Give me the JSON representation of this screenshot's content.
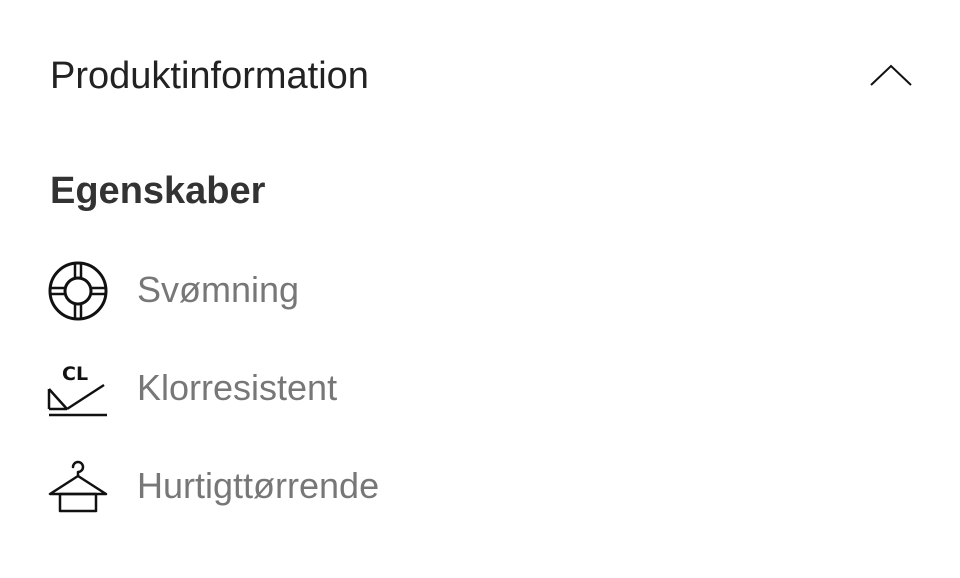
{
  "accordion": {
    "title": "Produktinformation",
    "state_icon": "chevron-up-icon"
  },
  "properties": {
    "heading": "Egenskaber",
    "items": [
      {
        "label": "Svømning",
        "icon": "lifebuoy-icon"
      },
      {
        "label": "Klorresistent",
        "icon": "chlorine-resistant-icon",
        "icon_text": "CL"
      },
      {
        "label": "Hurtigttørrende",
        "icon": "hanger-icon"
      }
    ]
  },
  "colors": {
    "title_text": "#222222",
    "heading_text": "#333333",
    "label_text": "#777777",
    "icon_stroke": "#111111",
    "background": "#ffffff"
  }
}
